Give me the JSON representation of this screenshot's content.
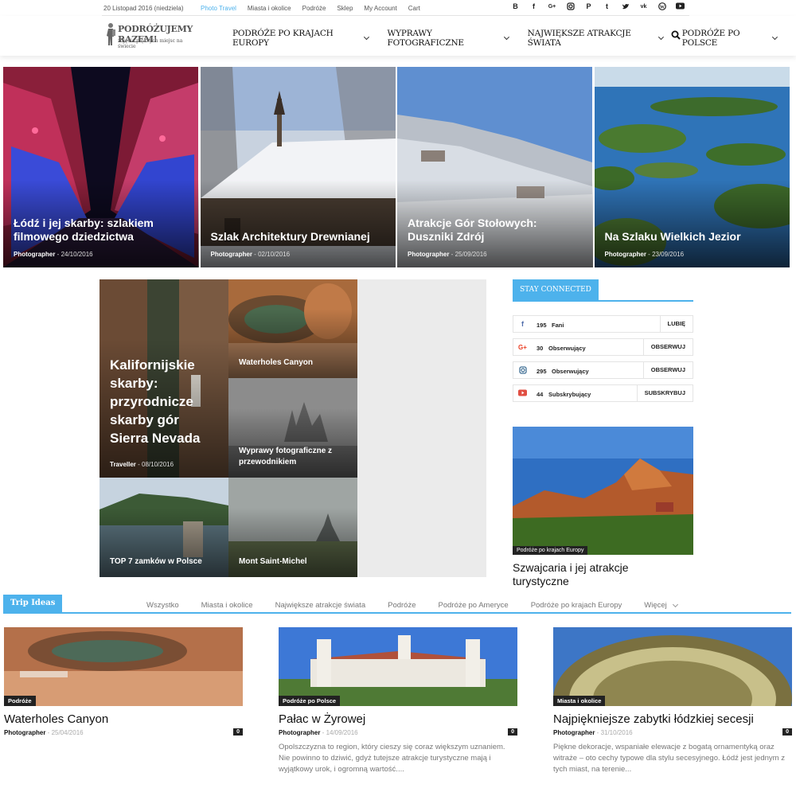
{
  "topbar": {
    "date": "20 Listopad 2016 (niedziela)",
    "links": [
      "Photo Travel",
      "Miasta i okolice",
      "Podróże",
      "Sklep",
      "My Account",
      "Cart"
    ],
    "social_icons": [
      "blogger-icon",
      "facebook-icon",
      "google-plus-icon",
      "instagram-icon",
      "pinterest-icon",
      "tumblr-icon",
      "twitter-icon",
      "vk-icon",
      "wordpress-icon",
      "youtube-icon"
    ]
  },
  "logo": {
    "line1": "PODRÓŻUJEMY RAZEM!",
    "line2": "zdjęcia pięknych miejsc na świecie"
  },
  "nav": {
    "items": [
      "PODRÓŻE PO KRAJACH EUROPY",
      "WYPRAWY FOTOGRAFICZNE",
      "NAJWIĘKSZE ATRAKCJE ŚWIATA",
      "PODRÓŻE PO POLSCE"
    ]
  },
  "hero": [
    {
      "title": "Łódź i jej skarby: szlakiem filmowego dziedzictwa",
      "author": "Photographer",
      "date": "24/10/2016"
    },
    {
      "title": "Szlak Architektury Drewnianej",
      "author": "Photographer",
      "date": "02/10/2016"
    },
    {
      "title": "Atrakcje Gór Stołowych: Duszniki Zdrój",
      "author": "Photographer",
      "date": "25/09/2016"
    },
    {
      "title": "Na Szlaku Wielkich Jezior",
      "author": "Photographer",
      "date": "23/09/2016"
    }
  ],
  "mosaic": {
    "big": {
      "title": "Kalifornijskie skarby: przyrodnicze skarby gór Sierra Nevada",
      "author": "Traveller",
      "date": "08/10/2016"
    },
    "small": [
      "Waterholes Canyon",
      "Wyprawy fotograficzne z przewodnikiem",
      "TOP 7 zamków w Polsce",
      "Mont Saint-Michel"
    ]
  },
  "sidebar": {
    "heading": "STAY CONNECTED",
    "rows": [
      {
        "icon": "facebook-icon",
        "count": "195",
        "label": "Fani",
        "button": "LUBIĘ",
        "color": "#516eab"
      },
      {
        "icon": "google-plus-icon",
        "count": "30",
        "label": "Obserwujący",
        "button": "OBSERWUJ",
        "color": "#eb4026"
      },
      {
        "icon": "instagram-icon",
        "count": "295",
        "label": "Obserwujący",
        "button": "OBSERWUJ",
        "color": "#417096"
      },
      {
        "icon": "youtube-icon",
        "count": "44",
        "label": "Subskrybujący",
        "button": "SUBSKRYBUJ",
        "color": "#e14e42"
      }
    ],
    "featured": {
      "category": "Podróże po krajach Europy",
      "title": "Szwajcaria i jej atrakcje turystyczne"
    }
  },
  "trip": {
    "label": "Trip Ideas",
    "tabs": [
      "Wszystko",
      "Miasta i okolice",
      "Największe atrakcje świata",
      "Podróże",
      "Podróże po Ameryce",
      "Podróże po krajach Europy",
      "Więcej"
    ]
  },
  "cards": [
    {
      "category": "Podróże",
      "title": "Waterholes Canyon",
      "author": "Photographer",
      "date": "25/04/2016",
      "comments": "0",
      "excerpt": ""
    },
    {
      "category": "Podróże po Polsce",
      "title": "Pałac w Żyrowej",
      "author": "Photographer",
      "date": "14/09/2016",
      "comments": "0",
      "excerpt": "Opolszczyzna to region, który cieszy się coraz większym uznaniem. Nie powinno to dziwić, gdyż tutejsze atrakcje turystyczne mają i wyjątkowy urok, i ogromną wartość...."
    },
    {
      "category": "Miasta i okolice",
      "title": "Najpiękniejsze zabytki łódzkiej secesji",
      "author": "Photographer",
      "date": "31/10/2016",
      "comments": "0",
      "excerpt": "Piękne dekoracje, wspaniałe elewacje z bogatą ornamentyką oraz witraże – oto cechy typowe dla stylu secesyjnego. Łódź jest jednym z tych miast, na terenie..."
    }
  ],
  "colors": {
    "accent": "#4db2ec",
    "dark": "#222222"
  }
}
